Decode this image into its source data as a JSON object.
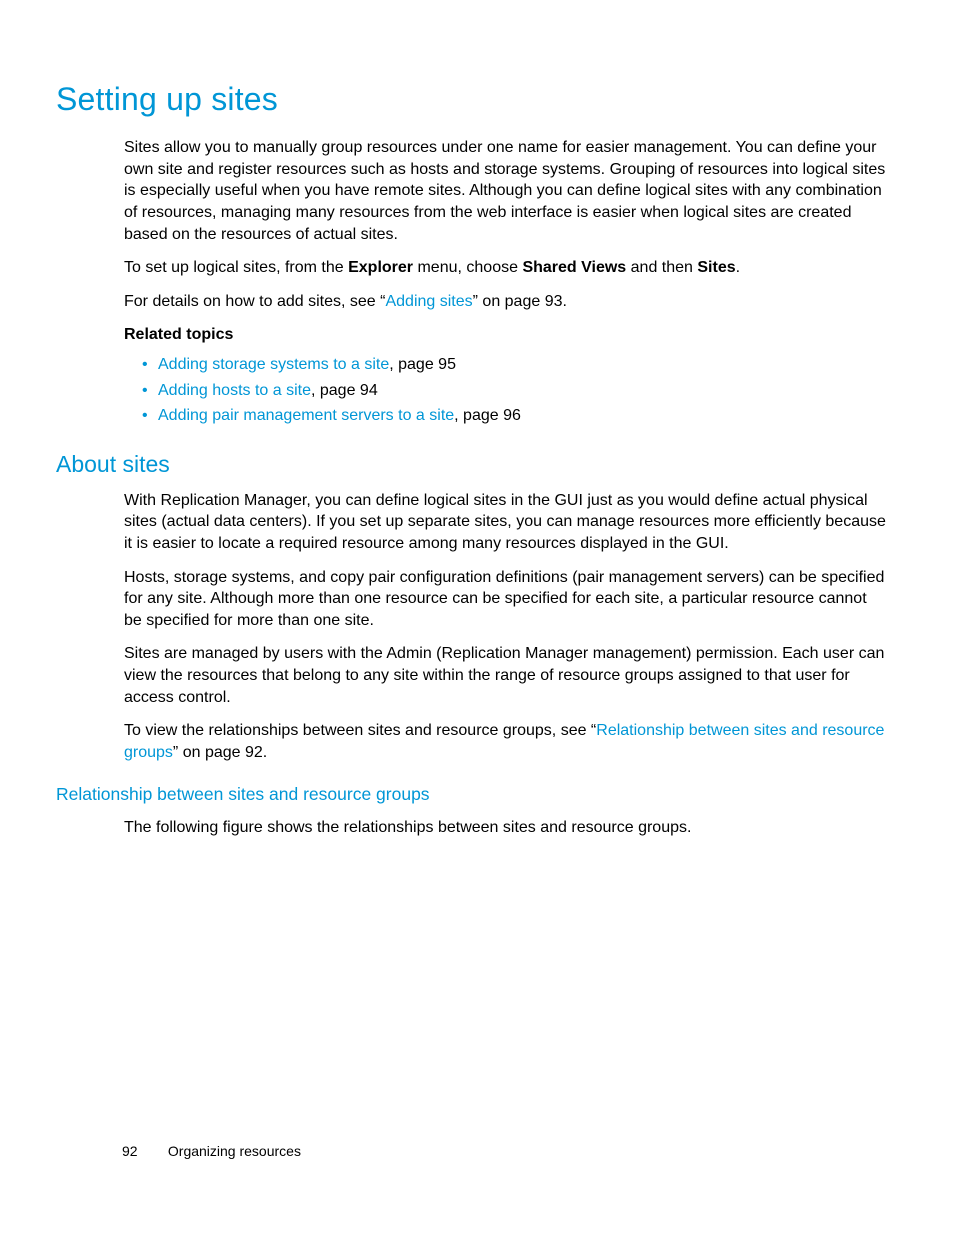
{
  "h1": "Setting up sites",
  "intro": {
    "p1": "Sites allow you to manually group resources under one name for easier management. You can define your own site and register resources such as hosts and storage systems. Grouping of resources into logical sites is especially useful when you have remote sites. Although you can define logical sites with any combination of resources, managing many resources from the web interface is easier when logical sites are created based on the resources of actual sites.",
    "p2_prefix": "To set up logical sites, from the ",
    "p2_b1": "Explorer",
    "p2_mid1": " menu, choose ",
    "p2_b2": "Shared Views",
    "p2_mid2": " and then ",
    "p2_b3": "Sites",
    "p2_suffix": ".",
    "p3_prefix": " For details on how to add sites, see “",
    "p3_link": "Adding sites",
    "p3_suffix": "” on page 93."
  },
  "related": {
    "heading": "Related topics",
    "items": [
      {
        "link": "Adding storage systems to a site",
        "suffix": ", page 95"
      },
      {
        "link": "Adding hosts to a site",
        "suffix": ", page 94"
      },
      {
        "link": "Adding pair management servers to a site",
        "suffix": ", page 96"
      }
    ]
  },
  "about": {
    "h2": "About sites",
    "p1": "With Replication Manager, you can define logical sites in the GUI just as you would define actual physical sites (actual data centers). If you set up separate sites, you can manage resources more efficiently because it is easier to locate a required resource among many resources displayed in the GUI.",
    "p2": "Hosts, storage systems, and copy pair configuration definitions (pair management servers) can be specified for any site. Although more than one resource can be specified for each site, a particular resource cannot be specified for more than one site.",
    "p3": "Sites are managed by users with the Admin (Replication Manager management) permission. Each user can view the resources that belong to any site within the range of resource groups assigned to that user for access control.",
    "p4_prefix": "To view the relationships between sites and resource groups, see “",
    "p4_link": "Relationship between sites and resource groups",
    "p4_suffix": "” on page 92."
  },
  "rel": {
    "h3": "Relationship between sites and resource groups",
    "p1": "The following figure shows the relationships between sites and resource groups."
  },
  "footer": {
    "page": "92",
    "section": "Organizing resources"
  }
}
